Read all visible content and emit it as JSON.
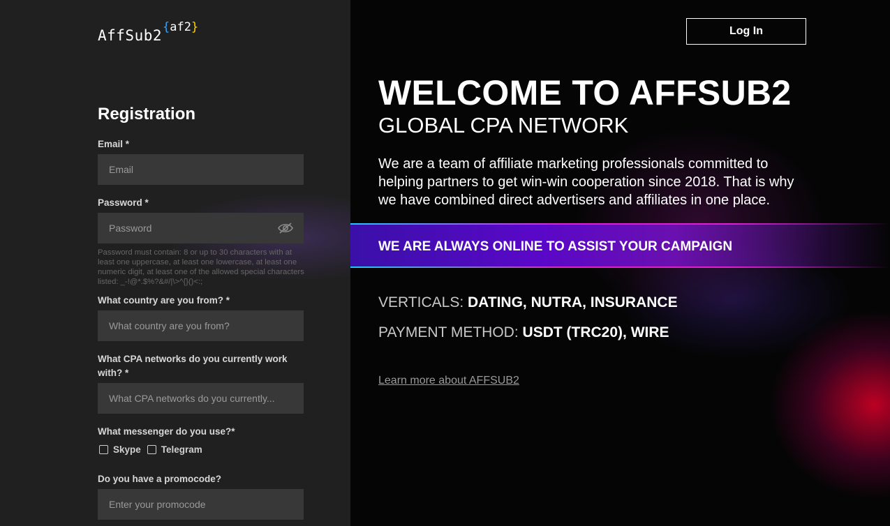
{
  "logo": {
    "main": "AffSub2",
    "brace_open": "{",
    "brace_text": "af2",
    "brace_close": "}"
  },
  "registration": {
    "title": "Registration",
    "email_label": "Email *",
    "email_placeholder": "Email",
    "password_label": "Password *",
    "password_placeholder": "Password",
    "password_hint": "Password must contain: 8 or up to 30 characters with at least one uppercase, at least one lowercase, at least one numeric digit, at least one of the allowed special characters listed: _-!@*.$%?&#/|\\>^{}()<:;",
    "country_label": "What country are you from? *",
    "country_placeholder": "What country are you from?",
    "cpa_label": "What CPA networks do you currently work with? *",
    "cpa_placeholder": "What CPA networks do you currently...",
    "messenger_label": "What messenger do you use?*",
    "messenger_options": [
      "Skype",
      "Telegram"
    ],
    "promo_label": "Do you have a promocode?",
    "promo_placeholder": "Enter your promocode"
  },
  "header": {
    "login_label": "Log In"
  },
  "hero": {
    "title": "WELCOME TO AFFSUB2",
    "subtitle": "GLOBAL CPA NETWORK",
    "description": "We are a team of affiliate marketing professionals committed to helping partners to get win-win cooperation since 2018. That is why we have combined direct advertisers and affiliates in one place.",
    "banner": "WE ARE ALWAYS ONLINE TO ASSIST YOUR CAMPAIGN",
    "verticals_label": "VERTICALS:",
    "verticals_value": "DATING, NUTRA, INSURANCE",
    "payment_label": "PAYMENT METHOD:",
    "payment_value": "USDT (TRC20), WIRE",
    "learn_more": "Learn more about AFFSUB2"
  },
  "colors": {
    "left_bg": "#202020",
    "field_bg": "#383838",
    "brace_blue": "#2fa4ff",
    "brace_yellow": "#ffd400",
    "banner_purple": "#5a08c8",
    "banner_border_pink": "#e020d0",
    "glow_red": "#dc0028"
  },
  "icons": {
    "password_toggle": "eye-off-icon"
  }
}
